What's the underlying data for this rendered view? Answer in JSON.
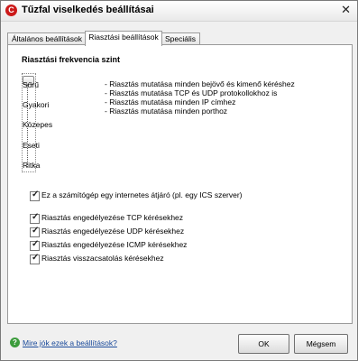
{
  "window": {
    "title": "Tűzfal viselkedés beállításai",
    "app_icon": "C",
    "close_glyph": "✕"
  },
  "tabs": [
    {
      "label": "Általános beállítások",
      "active": false
    },
    {
      "label": "Riasztási beállítások",
      "active": true
    },
    {
      "label": "Speciális",
      "active": false
    }
  ],
  "alert": {
    "section_title": "Riasztási frekvencia szint",
    "levels": [
      "Sűrű",
      "Gyakori",
      "Közepes",
      "Eseti",
      "Ritka"
    ],
    "selected_level": "Sűrű",
    "descriptions": [
      "- Riasztás mutatása minden bejövő és kimenő kéréshez",
      "- Riasztás mutatása TCP és UDP protokollokhoz is",
      "- Riasztás mutatása minden IP címhez",
      "- Riasztás mutatása minden porthoz"
    ]
  },
  "checkboxes": [
    {
      "label": "Ez a számítógép egy internetes átjáró (pl. egy ICS szerver)",
      "checked": true
    },
    {
      "label": "Riasztás engedélyezése TCP kérésekhez",
      "checked": true
    },
    {
      "label": "Riasztás engedélyezése UDP kérésekhez",
      "checked": true
    },
    {
      "label": "Riasztás engedélyezése ICMP kérésekhez",
      "checked": true
    },
    {
      "label": "Riasztás visszacsatolás kérésekhez",
      "checked": true
    }
  ],
  "footer": {
    "help_link": "Mire jók ezek a beállítások?",
    "help_icon": "?",
    "ok_label": "OK",
    "cancel_label": "Mégsem"
  }
}
